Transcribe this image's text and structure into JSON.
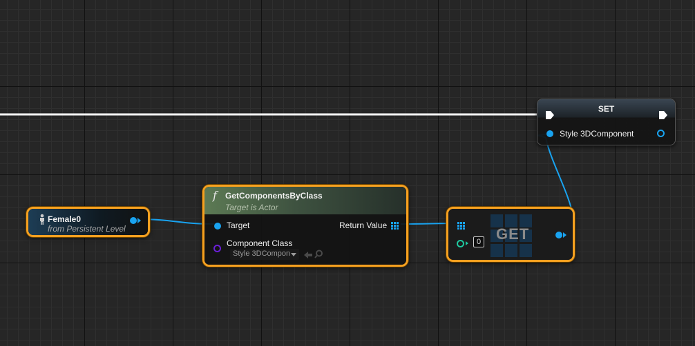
{
  "colors": {
    "object_pin": "#19a3f0",
    "class_pin": "#6a1fd6",
    "int_pin": "#1fc9a0",
    "selection": "#f5a020",
    "exec_wire": "#ffffff"
  },
  "nodes": {
    "female": {
      "title": "Female0",
      "subtitle": "from Persistent Level",
      "icon": "person-icon"
    },
    "get_components": {
      "title": "GetComponentsByClass",
      "subtitle": "Target is Actor",
      "icon": "function-icon",
      "function_glyph": "f",
      "target_label": "Target",
      "return_label": "Return Value",
      "component_class_label": "Component Class",
      "component_class_value": "Style 3DCompon",
      "use_icon": "arrow-left-icon",
      "browse_icon": "search-icon"
    },
    "get": {
      "title": "GET",
      "index_value": "0"
    },
    "set": {
      "title": "SET",
      "variable_label": "Style 3DComponent"
    }
  }
}
